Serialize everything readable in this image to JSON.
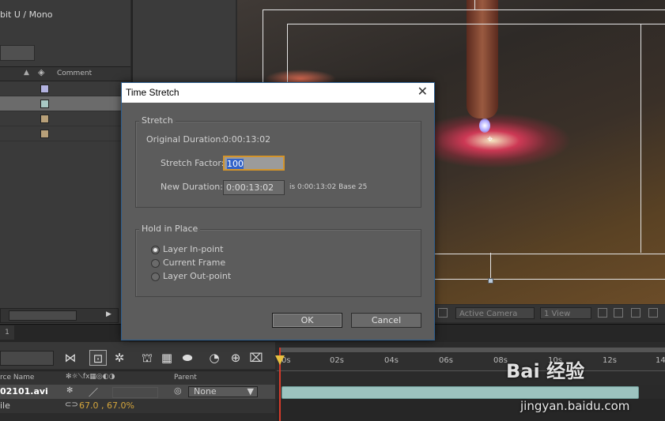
{
  "project": {
    "info_text": "bit U / Mono",
    "columns": {
      "comment": "Comment"
    },
    "row_colors": [
      "#b3b3e0",
      "#a8c8c4",
      "#b8a079",
      "#b8a079"
    ]
  },
  "composition": {
    "toolbar": {
      "camera": "Active Camera",
      "views": "1 View"
    }
  },
  "timeline": {
    "tab_label": "1",
    "columns": {
      "source_name": "rce Name",
      "parent": "Parent"
    },
    "layer": {
      "name": "02101.avi",
      "parent": "None"
    },
    "property": {
      "name": "ile",
      "value": "67.0 , 67.0%"
    },
    "ruler": [
      "0s",
      "02s",
      "04s",
      "06s",
      "08s",
      "10s",
      "12s",
      "14"
    ]
  },
  "dialog": {
    "title": "Time Stretch",
    "stretch_group": "Stretch",
    "original_duration_label": "Original Duration:",
    "original_duration_value": "0:00:13:02",
    "stretch_factor_label": "Stretch Factor:",
    "stretch_factor_value": "100",
    "new_duration_label": "New Duration:",
    "new_duration_value": "0:00:13:02",
    "new_duration_info": "is 0:00:13:02  Base 25",
    "hold_group": "Hold in Place",
    "options": [
      "Layer In-point",
      "Current Frame",
      "Layer Out-point"
    ],
    "selected_option": 0,
    "ok_label": "OK",
    "cancel_label": "Cancel"
  },
  "watermark": {
    "logo": "Bai 经验",
    "url": "jingyan.baidu.com"
  }
}
